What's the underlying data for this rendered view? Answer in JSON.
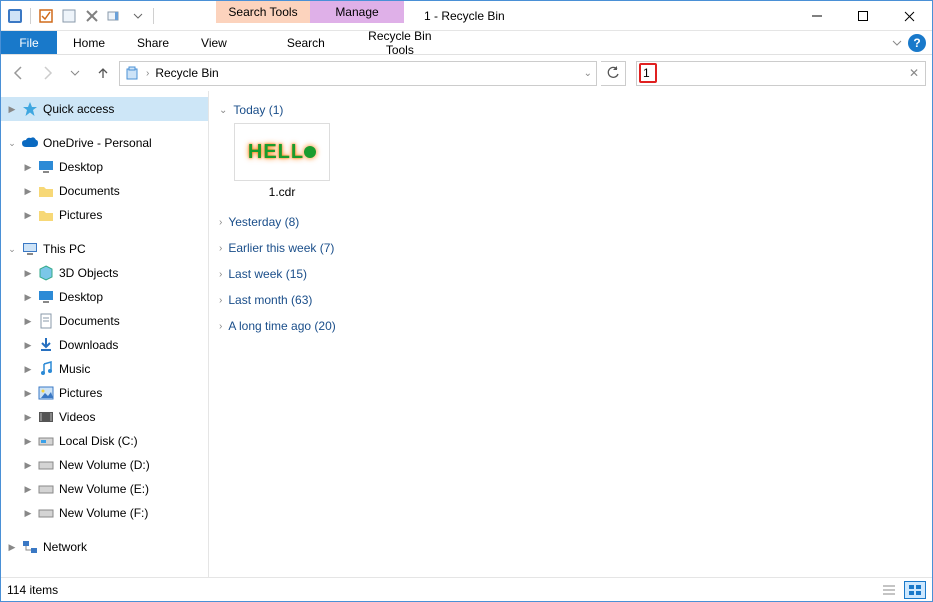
{
  "window": {
    "title": "1 - Recycle Bin"
  },
  "context_tabs": {
    "search": "Search Tools",
    "manage": "Manage"
  },
  "ribbon": {
    "file": "File",
    "home": "Home",
    "share": "Share",
    "view": "View",
    "search_sub": "Search",
    "manage_sub": "Recycle Bin Tools"
  },
  "address": {
    "location": "Recycle Bin"
  },
  "search": {
    "value": "1"
  },
  "nav": {
    "quick_access": "Quick access",
    "onedrive": "OneDrive - Personal",
    "od_desktop": "Desktop",
    "od_documents": "Documents",
    "od_pictures": "Pictures",
    "this_pc": "This PC",
    "pc_3d": "3D Objects",
    "pc_desktop": "Desktop",
    "pc_documents": "Documents",
    "pc_downloads": "Downloads",
    "pc_music": "Music",
    "pc_pictures": "Pictures",
    "pc_videos": "Videos",
    "pc_diskc": "Local Disk (C:)",
    "pc_diskd": "New Volume (D:)",
    "pc_diske": "New Volume (E:)",
    "pc_diskf": "New Volume (F:)",
    "network": "Network"
  },
  "groups": {
    "today": "Today (1)",
    "yesterday": "Yesterday (8)",
    "earlier_week": "Earlier this week (7)",
    "last_week": "Last week (15)",
    "last_month": "Last month (63)",
    "long_ago": "A long time ago (20)"
  },
  "items": {
    "file1": "1.cdr"
  },
  "status": {
    "count": "114 items"
  }
}
